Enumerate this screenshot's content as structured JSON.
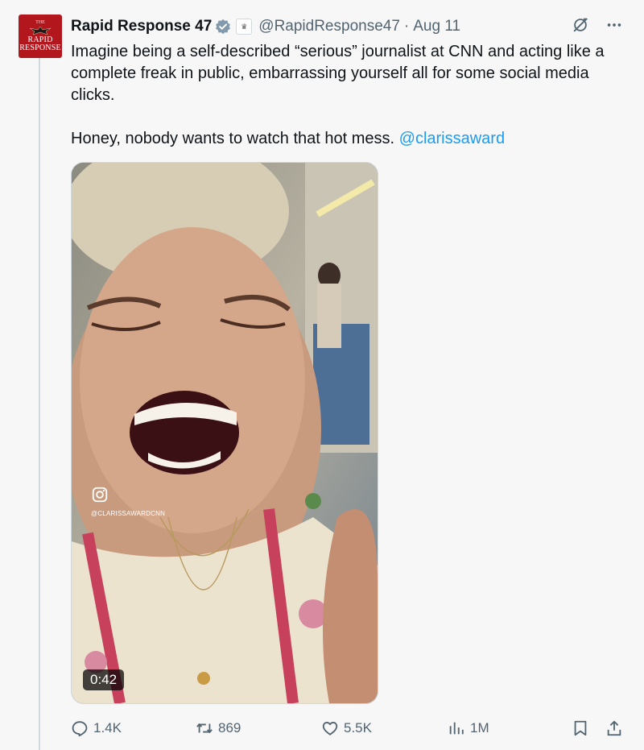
{
  "tweet": {
    "author_name": "Rapid Response 47",
    "handle": "@RapidResponse47",
    "separator": "·",
    "date": "Aug 11",
    "avatar": {
      "top": "THE",
      "line1": "RAPID",
      "line2": "RESPONSE"
    },
    "text_before_mention": "Imagine being a self-described “serious” journalist at CNN and acting like a complete freak in public, embarrassing yourself all for some social media clicks.\n\nHoney, nobody wants to watch that hot mess. ",
    "mention": "@clarissaward",
    "verified_color": "#829aab",
    "mention_color": "#1d9bf0"
  },
  "media": {
    "overlay_handle": "@CLARISSAWARDCNN",
    "duration": "0:42"
  },
  "actions": {
    "replies": "1.4K",
    "reposts": "869",
    "likes": "5.5K",
    "views": "1M"
  },
  "icons": [
    "verified-badge-icon",
    "affiliate-badge-icon",
    "grok-icon",
    "more-icon",
    "instagram-icon",
    "reply-icon",
    "repost-icon",
    "like-icon",
    "views-icon",
    "bookmark-icon",
    "share-icon"
  ]
}
